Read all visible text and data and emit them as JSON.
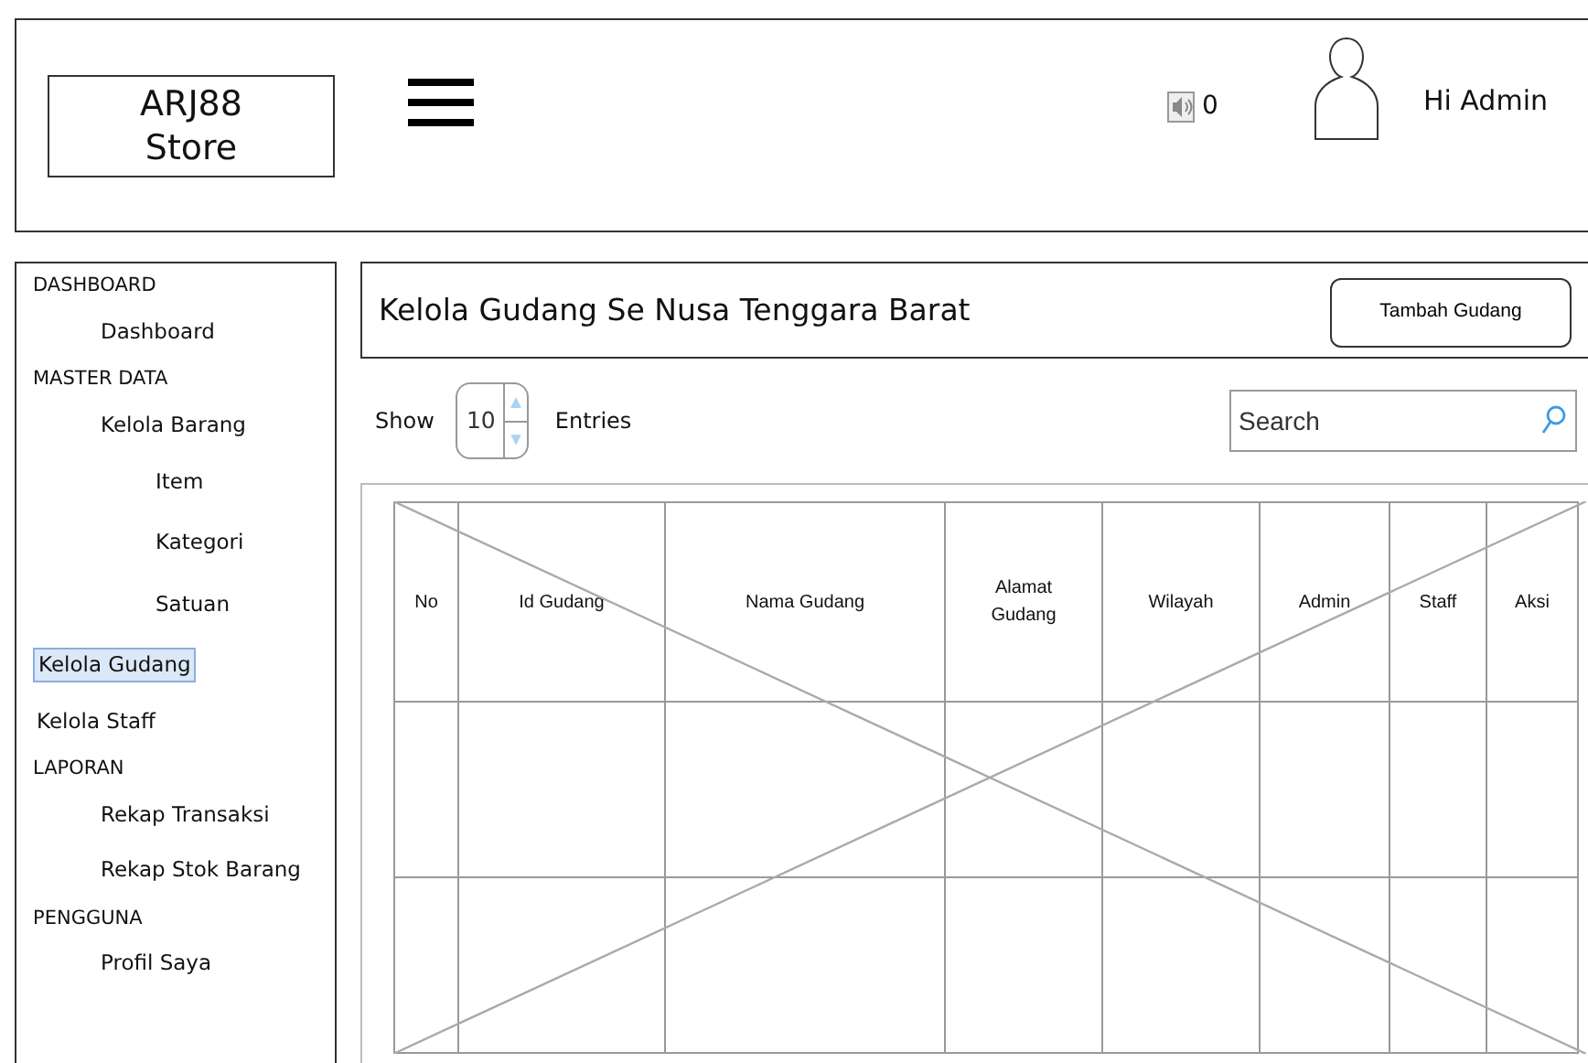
{
  "header": {
    "logo": "ARJ88 Store",
    "notifications": {
      "count": "0"
    },
    "greeting": "Hi Admin"
  },
  "sidebar": {
    "entries": [
      {
        "kind": "heading",
        "label": "DASHBOARD",
        "selected": false
      },
      {
        "kind": "item",
        "label": "Dashboard",
        "selected": false
      },
      {
        "kind": "heading",
        "label": "MASTER DATA",
        "selected": false
      },
      {
        "kind": "item",
        "label": "Kelola Barang",
        "selected": false
      },
      {
        "kind": "subitem",
        "label": "Item",
        "selected": false
      },
      {
        "kind": "subitem",
        "label": "Kategori",
        "selected": false
      },
      {
        "kind": "subitem",
        "label": "Satuan",
        "selected": false
      },
      {
        "kind": "link",
        "label": "Kelola Gudang",
        "selected": true
      },
      {
        "kind": "link",
        "label": "Kelola Staff",
        "selected": false
      },
      {
        "kind": "heading",
        "label": "LAPORAN",
        "selected": false
      },
      {
        "kind": "item",
        "label": "Rekap Transaksi",
        "selected": false
      },
      {
        "kind": "item",
        "label": "Rekap Stok Barang",
        "selected": false
      },
      {
        "kind": "heading",
        "label": "PENGGUNA",
        "selected": false
      },
      {
        "kind": "item",
        "label": "Profil Saya",
        "selected": false
      }
    ]
  },
  "page": {
    "title": "Kelola Gudang Se Nusa Tenggara Barat",
    "add_button": "Tambah Gudang"
  },
  "controls": {
    "show_label": "Show",
    "entries_value": "10",
    "entries_label": "Entries",
    "search": {
      "placeholder": "Search"
    }
  },
  "table": {
    "columns": [
      "No",
      "Id Gudang",
      "Nama Gudang",
      "Alamat Gudang",
      "Wilayah",
      "Admin",
      "Staff",
      "Aksi"
    ]
  }
}
